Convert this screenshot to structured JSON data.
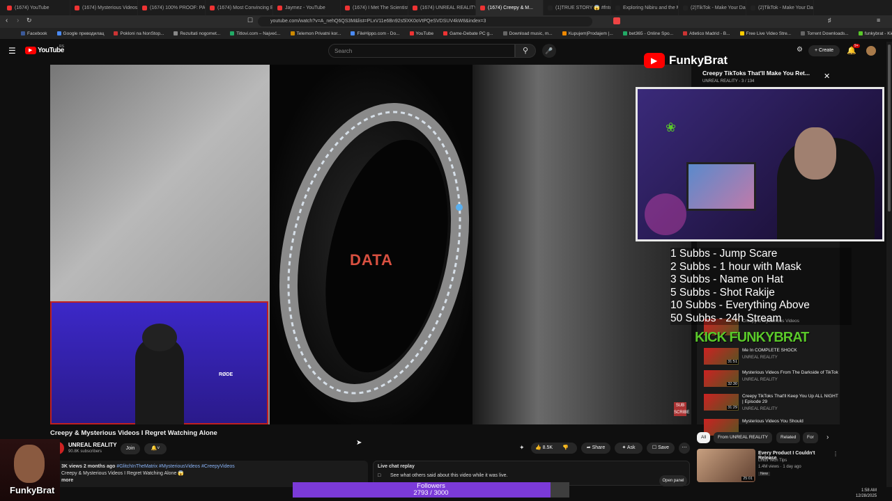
{
  "browser": {
    "tabs": [
      {
        "label": "(1674) YouTube",
        "color": "#e33"
      },
      {
        "label": "(1674) Mysterious Videos I...",
        "color": "#e33"
      },
      {
        "label": "(1674) 100% PROOF: PARA...",
        "color": "#e33"
      },
      {
        "label": "(1674) Most Convincing Evi...",
        "color": "#e33"
      },
      {
        "label": "Jaymez - YouTube",
        "color": "#e33"
      },
      {
        "label": "(1674) I Met The Scientist...",
        "color": "#e33"
      },
      {
        "label": "(1674) UNREAL REALITY - Y...",
        "color": "#e33"
      },
      {
        "label": "(1674) Creepy & M...",
        "color": "#e33"
      },
      {
        "label": "(1)TRUE STORY 😱 #fntonio...",
        "color": "#222"
      },
      {
        "label": "Exploring Nibiru and the M...",
        "color": "#222"
      },
      {
        "label": "(2)TikTok - Make Your Day",
        "color": "#222"
      },
      {
        "label": "(2)TikTok - Make Your Day",
        "color": "#222"
      }
    ],
    "active_tab": 7,
    "url": "youtube.com/watch?v=A_nehQ6QS3M&list=PLxV11e6Bn92s5lXK0oVtPQeSVDSUV4kW8&index=3",
    "bookmarks": [
      {
        "label": "Facebook",
        "color": "#3b5998"
      },
      {
        "label": "Google преводилац",
        "color": "#4a8af4"
      },
      {
        "label": "Pokloni na NonStop...",
        "color": "#c33"
      },
      {
        "label": "Rezultati nogomet...",
        "color": "#888"
      },
      {
        "label": "Titlovi.com – Najveć...",
        "color": "#2a6"
      },
      {
        "label": "Telemon Privatni kor...",
        "color": "#c80"
      },
      {
        "label": "FileHippo.com - Do...",
        "color": "#4a8af4"
      },
      {
        "label": "YouTube",
        "color": "#e33"
      },
      {
        "label": "Game-Debate PC g...",
        "color": "#e33"
      },
      {
        "label": "Download music, m...",
        "color": "#666"
      },
      {
        "label": "Kupujem|Prodajem |...",
        "color": "#e80"
      },
      {
        "label": "bet365 - Online Spo...",
        "color": "#2a6"
      },
      {
        "label": "Atletico Madrid - B...",
        "color": "#c33"
      },
      {
        "label": "Free Live Video Stre...",
        "color": "#fc0"
      },
      {
        "label": "Torrent Downloads...",
        "color": "#666"
      },
      {
        "label": "funkybrat - Kick Stat...",
        "color": "#5ac82a"
      }
    ]
  },
  "youtube": {
    "logo": "YouTube",
    "region": "RS",
    "search_placeholder": "Search",
    "create_label": "Create",
    "notif_badge": "9+"
  },
  "video": {
    "overlay_word": "DATA",
    "title": "Creepy & Mysterious Videos I Regret Watching Alone",
    "channel": "UNREAL REALITY",
    "subscribers": "90.8K subscribers",
    "join_label": "Join",
    "likes": "8.5K",
    "share_label": "Share",
    "ask_label": "Ask",
    "save_label": "Save",
    "desc_stats": "3K views  2 months ago",
    "desc_tags": " #GlitchInTheMatrix #MysteriousVideos #CreepyVideos",
    "desc_line2": "Creepy & Mysterious Videos I Regret Watching Alone 😱",
    "desc_more": "more",
    "chat_title": "Live chat replay",
    "chat_sub": "See what others said about this video while it was live.",
    "chat_button": "Open panel",
    "sub_badge": "SUB SCRIBE"
  },
  "overlay": {
    "streamer": "FunkyBrat",
    "mini_title": "Creepy TikToks That'll Make You Ret...",
    "mini_sub": "UNREAL REALITY - 3 / 134",
    "goals": [
      "1 Subbs - Jump Scare",
      "2 Subbs - 1 hour with Mask",
      "3 Subbs - Name on Hat",
      "5 Subbs - Shot Rakije",
      "10 Subbs - Everything Above",
      "50 Subbs - 24h Stream"
    ],
    "kick_logo": "KICK FUNKYBRAT",
    "followers_label": "Followers",
    "followers_current": 2793,
    "followers_goal": 3000,
    "followers_text": "2793 / 3000",
    "corner_name": "FunkyBrat"
  },
  "playlist": {
    "items": [
      {
        "title": "Creepy & Mysterious Videos",
        "channel": "",
        "duration": ""
      },
      {
        "title": "Me In COMPLETE SHOCK",
        "channel": "UNREAL REALITY",
        "duration": "31:51"
      },
      {
        "title": "Mysterious Videos From The Darkside of TikTok",
        "channel": "UNREAL REALITY",
        "duration": "32:30"
      },
      {
        "title": "Creepy TikToks That'll Keep You Up ALL NIGHT | Episode 29",
        "channel": "UNREAL REALITY",
        "duration": "31:29"
      },
      {
        "title": "Mysterious Videos You Should",
        "channel": "",
        "duration": ""
      }
    ]
  },
  "chips": [
    "All",
    "From UNREAL REALITY",
    "Related",
    "For"
  ],
  "recommended": {
    "title": "Every Product I Couldn't Release",
    "channel": "Linus Tech Tips",
    "meta": "1.4M views · 1 day ago",
    "badge": "New",
    "duration": "25:01"
  },
  "system": {
    "time": "1:58 AM",
    "date": "12/28/2025"
  }
}
